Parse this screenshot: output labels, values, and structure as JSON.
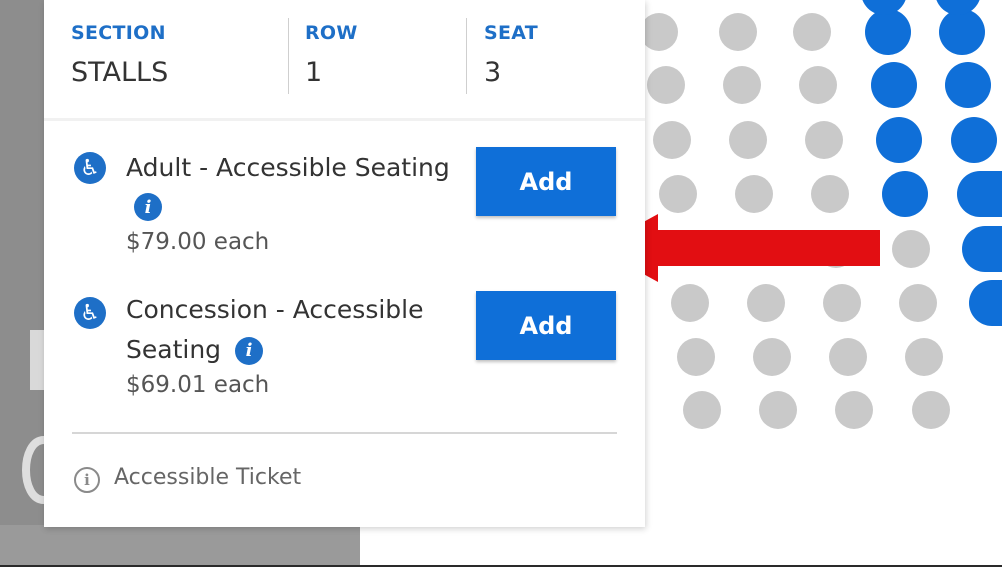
{
  "seat_info": {
    "section_label": "SECTION",
    "section_value": "STALLS",
    "row_label": "ROW",
    "row_value": "1",
    "seat_label": "SEAT",
    "seat_value": "3"
  },
  "tickets": [
    {
      "name_part1": "Adult - Accessible Seating",
      "name_part2": "",
      "price": "$79.00 each",
      "add_label": "Add",
      "icon": "wheelchair-icon"
    },
    {
      "name_part1": "Concession - Accessible",
      "name_part2": "Seating",
      "price": "$69.01 each",
      "add_label": "Add",
      "icon": "wheelchair-icon"
    }
  ],
  "footer": {
    "label": "Accessible Ticket",
    "icon": "info-outline-icon"
  },
  "colors": {
    "accent": "#1e6fc7",
    "button": "#0f6fd8",
    "seat_available": "#0f6fd8",
    "seat_unavailable": "#c9c9c9",
    "arrow": "#e20e12"
  }
}
